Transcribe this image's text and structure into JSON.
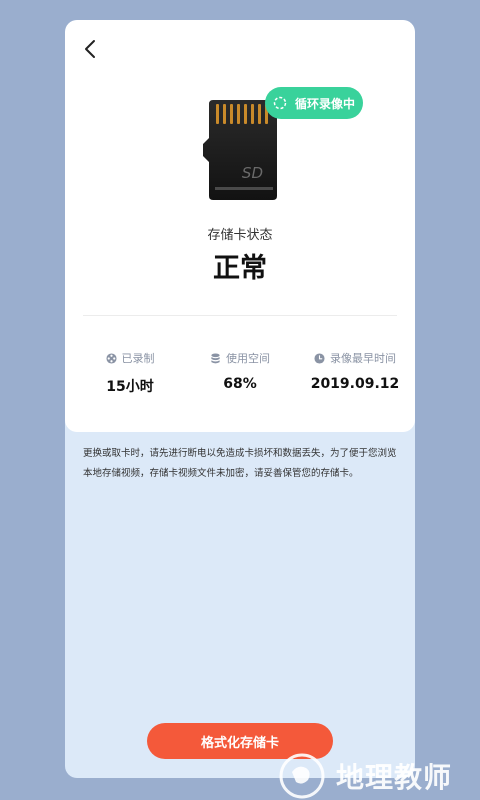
{
  "header": {
    "back_icon": "chevron-left-icon"
  },
  "status": {
    "badge_label": "循环录像中",
    "state_label": "存储卡状态",
    "state_value": "正常",
    "sd_label": "SD"
  },
  "stats": [
    {
      "icon": "film-reel-icon",
      "label": "已录制",
      "value": "15小时"
    },
    {
      "icon": "database-icon",
      "label": "使用空间",
      "value": "68%"
    },
    {
      "icon": "clock-icon",
      "label": "录像最早时间",
      "value": "2019.09.12"
    }
  ],
  "notice": "更换或取卡时，请先进行断电以免造成卡损坏和数据丢失，为了便于您浏览本地存储视频，存储卡视频文件未加密，请妥善保管您的存储卡。",
  "format_button": "格式化存储卡",
  "watermark": {
    "text": "地理教师"
  },
  "colors": {
    "background": "#9aaece",
    "sheet": "#dce9f8",
    "badge": "#39d29b",
    "button": "#f4593a"
  }
}
